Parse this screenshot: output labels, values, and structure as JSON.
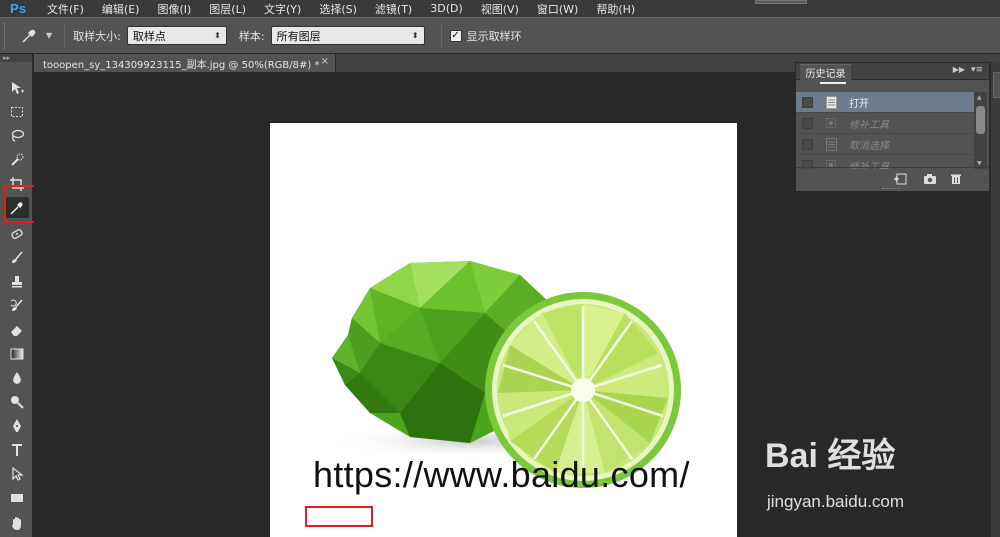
{
  "app": {
    "logo": "Ps",
    "menus": [
      "文件(F)",
      "编辑(E)",
      "图像(I)",
      "图层(L)",
      "文字(Y)",
      "选择(S)",
      "滤镜(T)",
      "3D(D)",
      "视图(V)",
      "窗口(W)",
      "帮助(H)"
    ]
  },
  "options": {
    "sample_size_label": "取样大小:",
    "sample_size_value": "取样点",
    "sample_label": "样本:",
    "sample_value": "所有图层",
    "show_ring_label": "显示取样环",
    "show_ring_checked": "✓"
  },
  "document": {
    "tab_title": "tooopen_sy_134309923115_副本.jpg @ 50%(RGB/8#) *",
    "close": "×",
    "canvas_text": "https://www.baidu.com/"
  },
  "history": {
    "tab_label": "历史记录",
    "items": [
      {
        "label": "打开",
        "state": "selected"
      },
      {
        "label": "修补工具",
        "state": "dim"
      },
      {
        "label": "取消选择",
        "state": "dim"
      },
      {
        "label": "修补工具",
        "state": "dim"
      }
    ]
  },
  "watermark": {
    "brand": "Bai 经验",
    "site": "jingyan.baidu.com"
  },
  "colors": {
    "ps_blue": "#31a8ff",
    "highlight_red": "#e21d1d",
    "selected_history": "#6e7b8c"
  }
}
